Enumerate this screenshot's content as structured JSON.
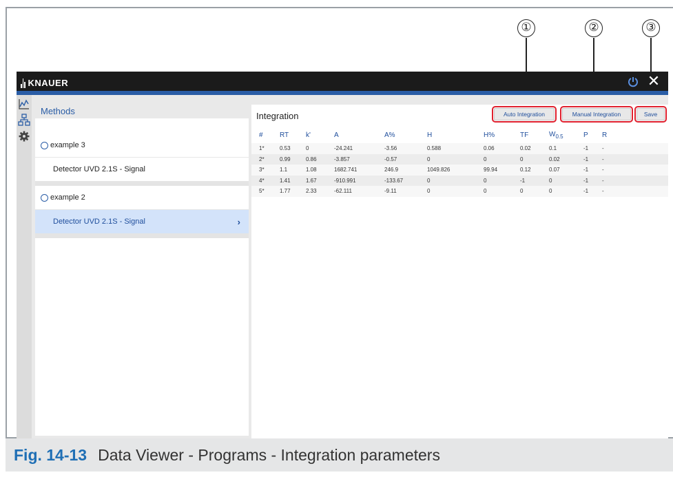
{
  "callouts": [
    "①",
    "②",
    "③"
  ],
  "app": {
    "brand": "KNAUER",
    "close_glyph": "✕",
    "methods_title": "Methods",
    "groups": [
      {
        "name": "example 3",
        "items": [
          {
            "label": "Detector UVD 2.1S - Signal",
            "selected": false
          }
        ]
      },
      {
        "name": "example 2",
        "items": [
          {
            "label": "Detector UVD 2.1S - Signal",
            "selected": true
          }
        ]
      }
    ],
    "chevron_glyph": "›",
    "rail_icons": [
      "chart-icon",
      "network-icon",
      "gear-icon"
    ]
  },
  "integration": {
    "title": "Integration",
    "buttons": {
      "auto": "Auto Integration",
      "manual": "Manual Integration",
      "save": "Save"
    },
    "headers": [
      "#",
      "RT",
      "k'",
      "A",
      "A%",
      "H",
      "H%",
      "TF",
      "W0.5",
      "P",
      "R"
    ],
    "rows": [
      [
        "1*",
        "0.53",
        "0",
        "-24.241",
        "-3.56",
        "0.588",
        "0.06",
        "0.02",
        "0.1",
        "-1",
        "-"
      ],
      [
        "2*",
        "0.99",
        "0.86",
        "-3.857",
        "-0.57",
        "0",
        "0",
        "0",
        "0.02",
        "-1",
        "-"
      ],
      [
        "3*",
        "1.1",
        "1.08",
        "1682.741",
        "246.9",
        "1049.826",
        "99.94",
        "0.12",
        "0.07",
        "-1",
        "-"
      ],
      [
        "4*",
        "1.41",
        "1.67",
        "-910.991",
        "-133.67",
        "0",
        "0",
        "-1",
        "0",
        "-1",
        "-"
      ],
      [
        "5*",
        "1.77",
        "2.33",
        "-62.111",
        "-9.11",
        "0",
        "0",
        "0",
        "0",
        "-1",
        "-"
      ]
    ]
  },
  "caption": {
    "number": "Fig. 14-13",
    "text": "Data Viewer - Programs - Integration parameters"
  },
  "colors": {
    "knauer_blue": "#2a5da6",
    "highlight_red": "#e0202e",
    "selected_row": "#d3e3fa"
  }
}
